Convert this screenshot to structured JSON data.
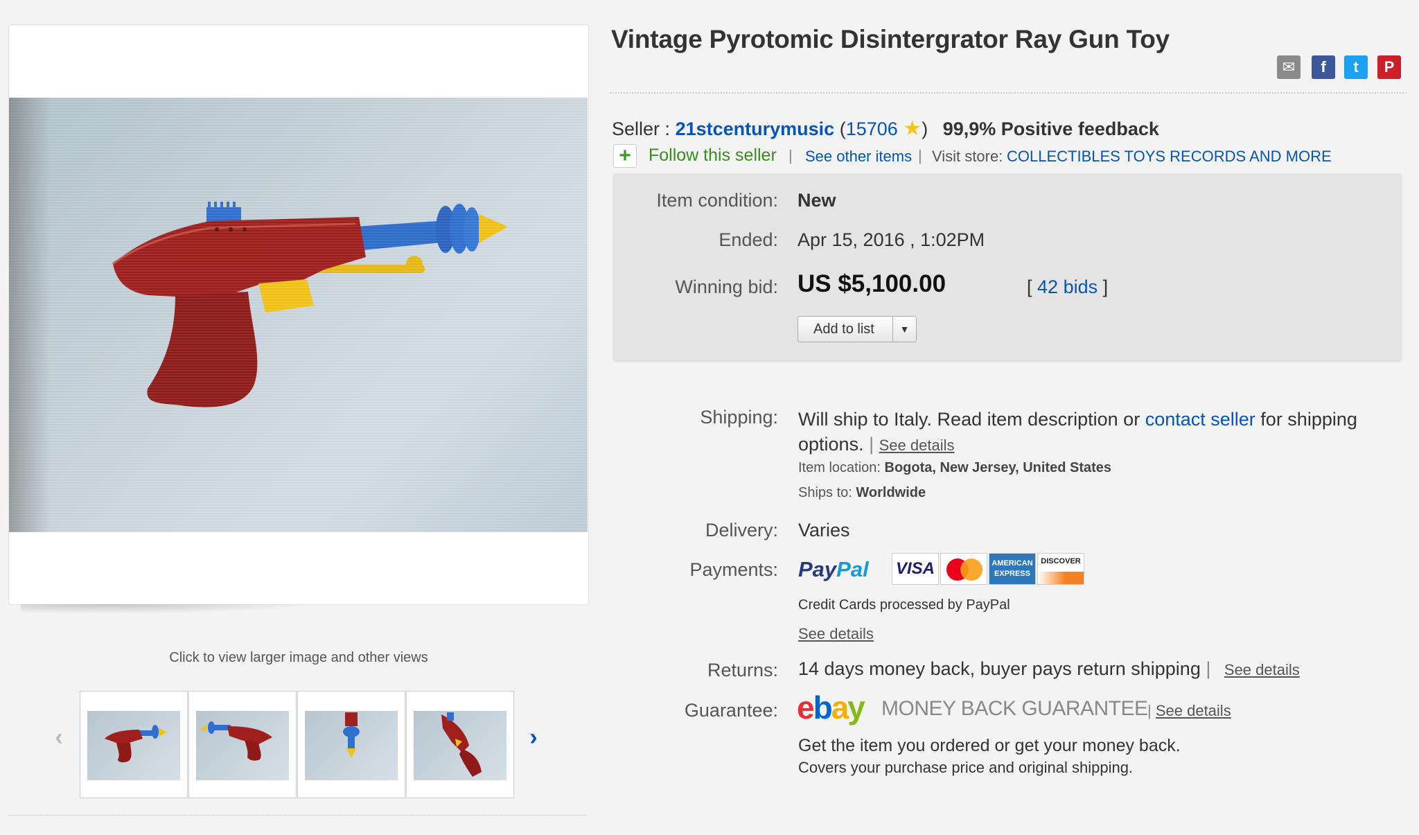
{
  "listing": {
    "title": "Vintage Pyrotomic Disintergrator Ray Gun Toy"
  },
  "images": {
    "click_hint": "Click to view larger image and other views",
    "thumbnail_count": 4
  },
  "share_icons": [
    "mail-icon",
    "facebook-icon",
    "twitter-icon",
    "pinterest-icon"
  ],
  "seller": {
    "label": "Seller :",
    "name": "21stcenturymusic",
    "open_paren": "(",
    "score": "15706",
    "close_paren": ")",
    "feedback": "99,9% Positive feedback",
    "follow": "Follow this seller",
    "other_items": "See other items",
    "visit_store_label": "Visit store:",
    "store_name": "COLLECTIBLES TOYS RECORDS AND MORE",
    "separator": "|"
  },
  "item": {
    "condition_label": "Item condition:",
    "condition": "New",
    "ended_label": "Ended:",
    "ended": "Apr 15, 2016 , 1:02PM",
    "bid_label": "Winning bid:",
    "price": "US $5,100.00",
    "bids_open": "[",
    "bids": "42 bids",
    "bids_close": "]",
    "add_to_list": "Add to list"
  },
  "shipping": {
    "label": "Shipping:",
    "text_1": "Will ship to Italy. Read item description or",
    "contact": "contact seller",
    "text_2": "for shipping",
    "text_3": "options.",
    "see_details": "See details",
    "location_label": "Item location:",
    "location": "Bogota, New Jersey, United States",
    "ships_to_label": "Ships to:",
    "ships_to": "Worldwide"
  },
  "delivery": {
    "label": "Delivery:",
    "value": "Varies"
  },
  "payments": {
    "label": "Payments:",
    "paypal_1": "Pay",
    "paypal_2": "Pal",
    "visa": "VISA",
    "amex": "AMERICAN EXPRESS",
    "discover": "DISCOVER",
    "note": "Credit Cards processed by PayPal",
    "see_details": "See details"
  },
  "returns": {
    "label": "Returns:",
    "value": "14 days money back, buyer pays return shipping",
    "see_details": "See details"
  },
  "guarantee": {
    "label": "Guarantee:",
    "logo_e": "e",
    "logo_b": "b",
    "logo_a": "a",
    "logo_y": "y",
    "badge": "MONEY BACK GUARANTEE",
    "see_details": "See details",
    "line_1": "Get the item you ordered or get your money back.",
    "line_2": "Covers your purchase price and original shipping."
  },
  "colors": {
    "link": "#0654ba",
    "follow_green": "#3a8d1e",
    "gun_red": "#9e1f1c",
    "gun_blue": "#2f6fd0",
    "gun_yellow": "#f2c316"
  }
}
